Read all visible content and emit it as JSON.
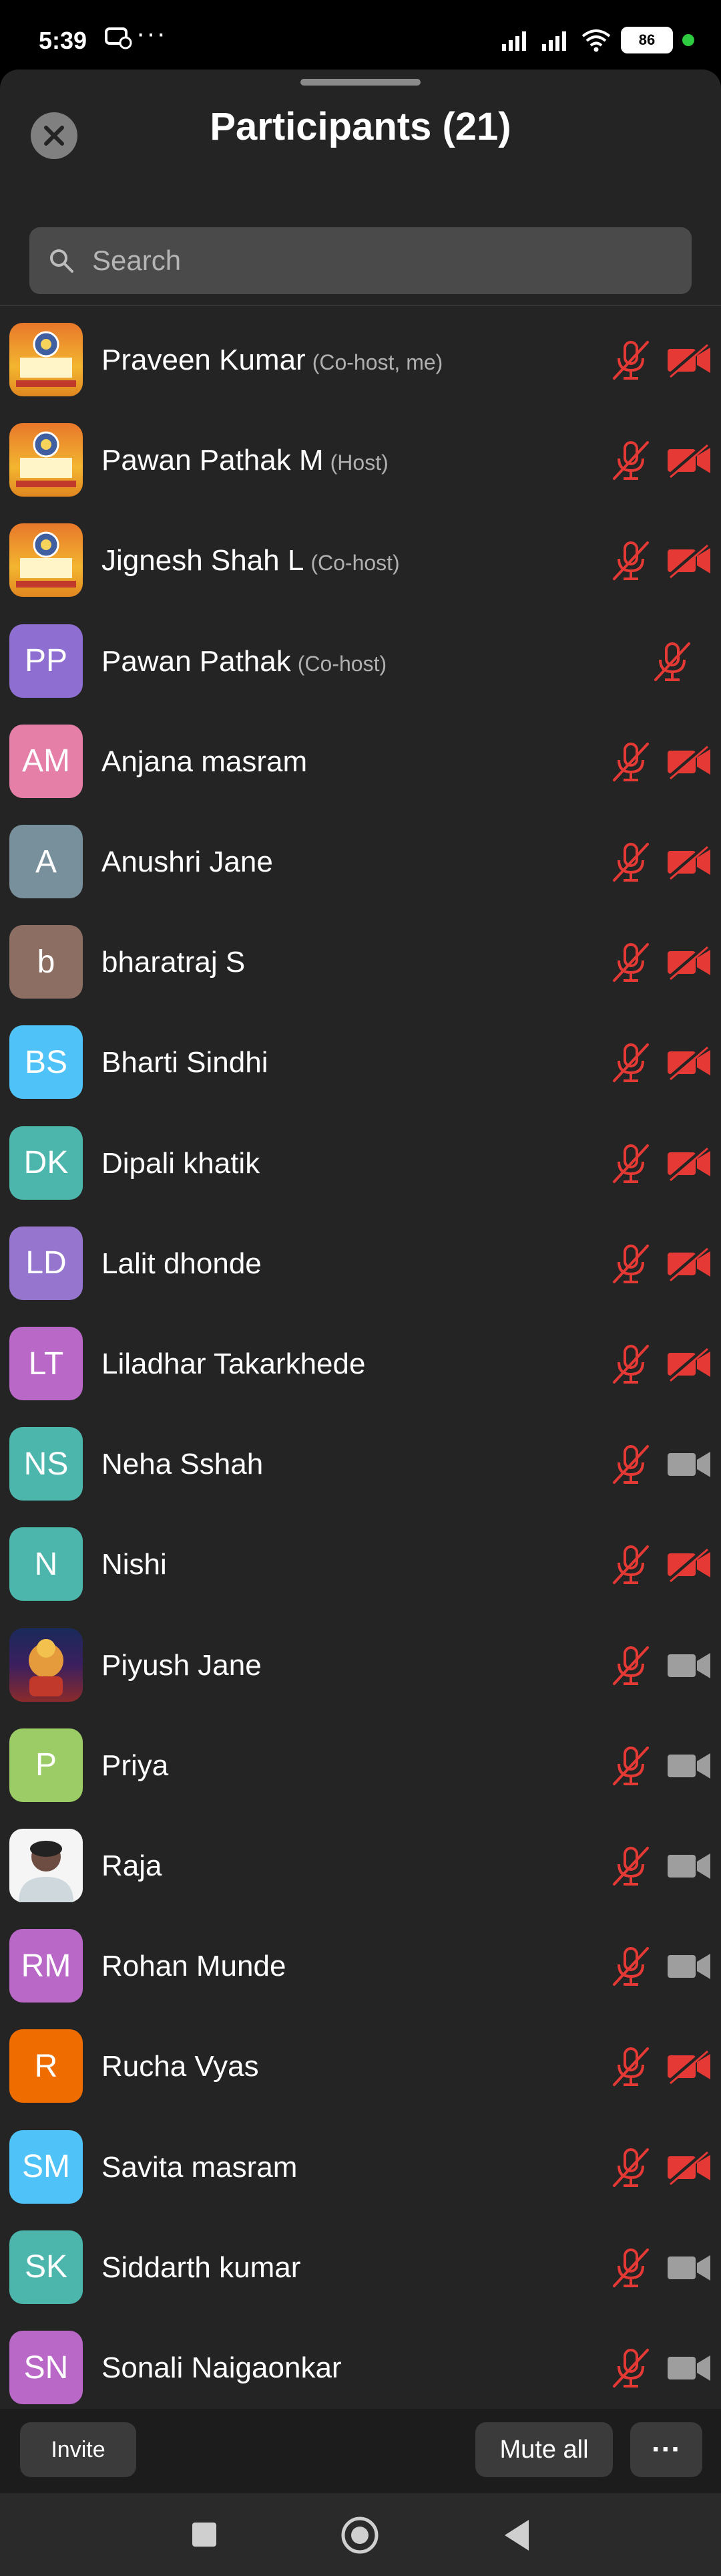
{
  "status_bar": {
    "time": "5:39",
    "dots": "···",
    "battery": "86"
  },
  "header": {
    "title": "Participants (21)"
  },
  "search": {
    "placeholder": "Search"
  },
  "participants": [
    {
      "name": "Praveen Kumar",
      "role": "(Co-host, me)",
      "initials": "",
      "avatar": "pdl-logo",
      "mic": "muted",
      "cam": "off"
    },
    {
      "name": "Pawan Pathak M",
      "role": "(Host)",
      "initials": "",
      "avatar": "pdl-logo",
      "mic": "muted",
      "cam": "off"
    },
    {
      "name": "Jignesh Shah L",
      "role": "(Co-host)",
      "initials": "",
      "avatar": "pdl-logo",
      "mic": "muted",
      "cam": "off"
    },
    {
      "name": "Pawan Pathak",
      "role": "(Co-host)",
      "initials": "PP",
      "avatar": "#8e6fd1",
      "mic": "muted",
      "cam": "none"
    },
    {
      "name": "Anjana masram",
      "role": "",
      "initials": "AM",
      "avatar": "#e57fa8",
      "mic": "muted",
      "cam": "off"
    },
    {
      "name": "Anushri Jane",
      "role": "",
      "initials": "A",
      "avatar": "#78909c",
      "mic": "muted",
      "cam": "off"
    },
    {
      "name": "bharatraj S",
      "role": "",
      "initials": "b",
      "avatar": "#8d6e63",
      "mic": "muted",
      "cam": "off"
    },
    {
      "name": "Bharti Sindhi",
      "role": "",
      "initials": "BS",
      "avatar": "#4fc3f7",
      "mic": "muted",
      "cam": "off"
    },
    {
      "name": "Dipali khatik",
      "role": "",
      "initials": "DK",
      "avatar": "#4db6ac",
      "mic": "muted",
      "cam": "off"
    },
    {
      "name": "Lalit dhonde",
      "role": "",
      "initials": "LD",
      "avatar": "#9575cd",
      "mic": "muted",
      "cam": "off"
    },
    {
      "name": "Liladhar Takarkhede",
      "role": "",
      "initials": "LT",
      "avatar": "#ba68c8",
      "mic": "muted",
      "cam": "off"
    },
    {
      "name": "Neha Sshah",
      "role": "",
      "initials": "NS",
      "avatar": "#4db6ac",
      "mic": "muted",
      "cam": "on"
    },
    {
      "name": "Nishi",
      "role": "",
      "initials": "N",
      "avatar": "#4db6ac",
      "mic": "muted",
      "cam": "off"
    },
    {
      "name": "Piyush Jane",
      "role": "",
      "initials": "",
      "avatar": "photo-deity",
      "mic": "muted",
      "cam": "on"
    },
    {
      "name": "Priya",
      "role": "",
      "initials": "P",
      "avatar": "#9ccc65",
      "mic": "muted",
      "cam": "on"
    },
    {
      "name": "Raja",
      "role": "",
      "initials": "",
      "avatar": "photo-person",
      "mic": "muted",
      "cam": "on"
    },
    {
      "name": "Rohan Munde",
      "role": "",
      "initials": "RM",
      "avatar": "#ba68c8",
      "mic": "muted",
      "cam": "on"
    },
    {
      "name": "Rucha Vyas",
      "role": "",
      "initials": "R",
      "avatar": "#ef6c00",
      "mic": "muted",
      "cam": "off"
    },
    {
      "name": "Savita masram",
      "role": "",
      "initials": "SM",
      "avatar": "#4fc3f7",
      "mic": "muted",
      "cam": "off"
    },
    {
      "name": "Siddarth kumar",
      "role": "",
      "initials": "SK",
      "avatar": "#4db6ac",
      "mic": "muted",
      "cam": "on"
    },
    {
      "name": "Sonali Naigaonkar",
      "role": "",
      "initials": "SN",
      "avatar": "#ba68c8",
      "mic": "muted",
      "cam": "on"
    }
  ],
  "footer": {
    "invite": "Invite",
    "mute_all": "Mute all",
    "more": "···"
  },
  "colors": {
    "muted_red": "#e53935",
    "sheet_bg": "#242424"
  }
}
